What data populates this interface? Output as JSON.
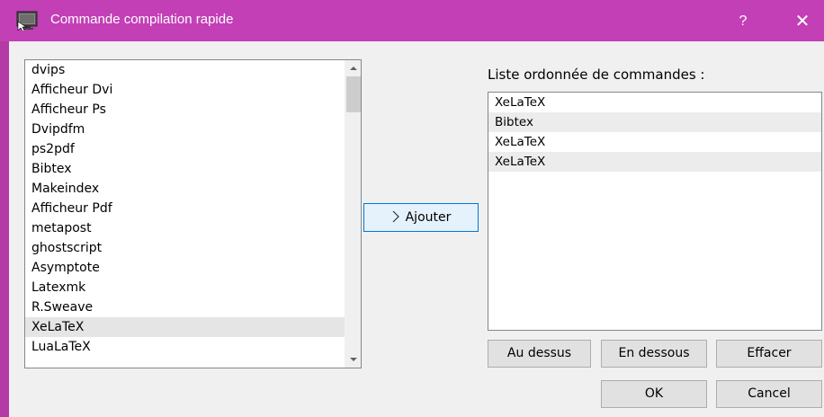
{
  "window": {
    "title": "Commande compilation rapide",
    "help_label": "?",
    "close_label": "✕",
    "icon": "app-monitor-icon",
    "titlebar_color": "#c33fb6"
  },
  "available": {
    "items": [
      "dvips",
      "Afficheur Dvi",
      "Afficheur Ps",
      "Dvipdfm",
      "ps2pdf",
      "Bibtex",
      "Makeindex",
      "Afficheur Pdf",
      "metapost",
      "ghostscript",
      "Asymptote",
      "Latexmk",
      "R.Sweave",
      "XeLaTeX",
      "LuaLaTeX"
    ],
    "selected": "XeLaTeX"
  },
  "add_button": {
    "label": "Ajouter",
    "icon": "chevron-right-icon"
  },
  "ordered": {
    "label": "Liste ordonnée de commandes :",
    "items": [
      "XeLaTeX",
      "Bibtex",
      "XeLaTeX",
      "XeLaTeX"
    ]
  },
  "buttons": {
    "up": "Au dessus",
    "down": "En dessous",
    "clear": "Effacer",
    "ok": "OK",
    "cancel": "Cancel"
  },
  "colors": {
    "accent": "#0078d7"
  }
}
